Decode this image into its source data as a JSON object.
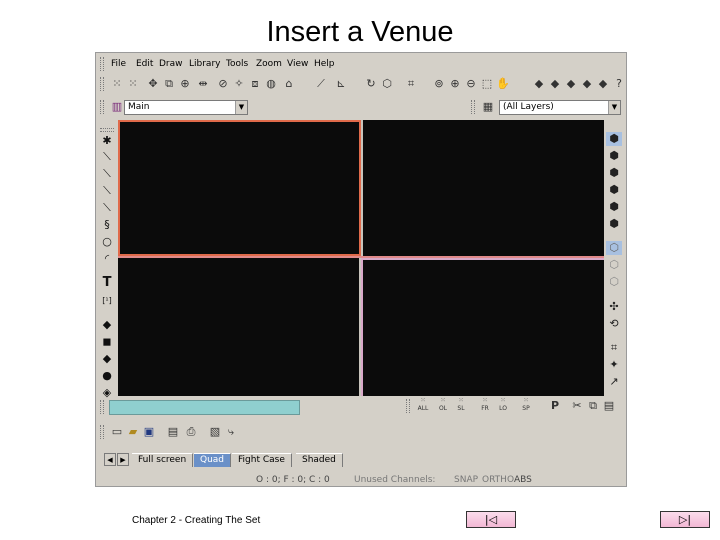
{
  "slide": {
    "title": "Insert a Venue",
    "footer": "Chapter 2 - Creating The Set",
    "nav": {
      "first_glyph": "|◁",
      "last_glyph": "▷|"
    }
  },
  "app": {
    "menu": [
      "File",
      "Edit",
      "Draw",
      "Library",
      "Tools",
      "Zoom",
      "View",
      "Help"
    ],
    "layer_combo": {
      "value": "Main"
    },
    "layers_combo": {
      "value": "(All Layers)"
    },
    "snap_buttons": [
      "ALL",
      "OL",
      "SL",
      "FR",
      "LO",
      "SP"
    ],
    "tabs": [
      "Full screen",
      "Quad",
      "Fight Case",
      "Shaded"
    ],
    "active_tab": "Quad",
    "status": {
      "counts": "O : 0; F : 0; C : 0",
      "channels": "Unused Channels:",
      "modes": [
        "SNAP",
        "ORTHO",
        "ABS"
      ]
    },
    "colors": {
      "viewport_bg": "#0b0b0b",
      "active_viewport_border": "#e06a4a",
      "command_line": "#8fcfcf",
      "active_tab": "#6a90c8"
    }
  }
}
